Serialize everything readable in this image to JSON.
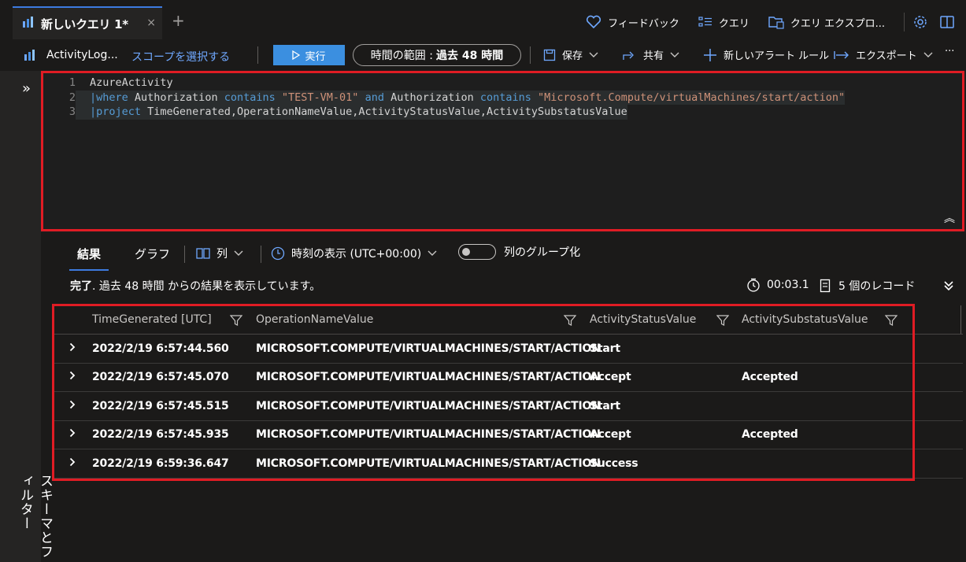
{
  "tabbar": {
    "tab_title": "新しいクエリ 1*",
    "close_glyph": "×",
    "add_glyph": "+",
    "feedback": "フィードバック",
    "queries": "クエリ",
    "query_explorer": "クエリ エクスプロ..."
  },
  "cmdbar": {
    "scope_name": "ActivityLog...",
    "select_scope": "スコープを選択する",
    "run": "実行",
    "time_range_label": "時間の範囲 :",
    "time_range_value": "過去 48 時間",
    "save": "保存",
    "share": "共有",
    "new_alert": "新しいアラート ルール",
    "export": "エクスポート",
    "more": "···"
  },
  "sidepanel": {
    "expand_glyph": "»",
    "label": "スキーマとフィルター"
  },
  "editor": {
    "lines": [
      {
        "num": "1",
        "tokens": [
          {
            "t": "AzureActivity",
            "c": ""
          }
        ]
      },
      {
        "num": "2",
        "tokens": [
          {
            "t": "|",
            "c": "pipe"
          },
          {
            "t": "where",
            "c": "kw"
          },
          {
            "t": " Authorization ",
            "c": ""
          },
          {
            "t": "contains",
            "c": "kw"
          },
          {
            "t": " ",
            "c": ""
          },
          {
            "t": "\"TEST-VM-01\"",
            "c": "str"
          },
          {
            "t": " ",
            "c": ""
          },
          {
            "t": "and",
            "c": "kw"
          },
          {
            "t": " Authorization ",
            "c": ""
          },
          {
            "t": "contains",
            "c": "kw"
          },
          {
            "t": " ",
            "c": ""
          },
          {
            "t": "\"Microsoft.Compute/virtualMachines/start/action\"",
            "c": "str"
          }
        ]
      },
      {
        "num": "3",
        "tokens": [
          {
            "t": "|",
            "c": "pipe"
          },
          {
            "t": "project",
            "c": "kw"
          },
          {
            "t": " TimeGenerated,OperationNameValue,ActivityStatusValue,ActivitySubstatusValue",
            "c": ""
          }
        ]
      }
    ],
    "collapse_glyph": "︽"
  },
  "results": {
    "tab_results": "結果",
    "tab_chart": "グラフ",
    "columns_btn": "列",
    "time_display": "時刻の表示 (UTC+00:00)",
    "group_columns": "列のグループ化",
    "status_done": "完了",
    "status_text": ". 過去 48 時間 からの結果を表示しています。",
    "duration": "00:03.1",
    "records": "5 個のレコード",
    "headers": [
      "TimeGenerated [UTC]",
      "OperationNameValue",
      "ActivityStatusValue",
      "ActivitySubstatusValue"
    ],
    "rows": [
      [
        "2022/2/19 6:57:44.560",
        "MICROSOFT.COMPUTE/VIRTUALMACHINES/START/ACTION",
        "Start",
        ""
      ],
      [
        "2022/2/19 6:57:45.070",
        "MICROSOFT.COMPUTE/VIRTUALMACHINES/START/ACTION",
        "Accept",
        "Accepted"
      ],
      [
        "2022/2/19 6:57:45.515",
        "MICROSOFT.COMPUTE/VIRTUALMACHINES/START/ACTION",
        "Start",
        ""
      ],
      [
        "2022/2/19 6:57:45.935",
        "MICROSOFT.COMPUTE/VIRTUALMACHINES/START/ACTION",
        "Accept",
        "Accepted"
      ],
      [
        "2022/2/19 6:59:36.647",
        "MICROSOFT.COMPUTE/VIRTUALMACHINES/START/ACTION",
        "Success",
        ""
      ]
    ]
  },
  "colors": {
    "accent": "#3b8fe0",
    "highlight_frame": "#e01c24",
    "link": "#6fa8ff"
  }
}
